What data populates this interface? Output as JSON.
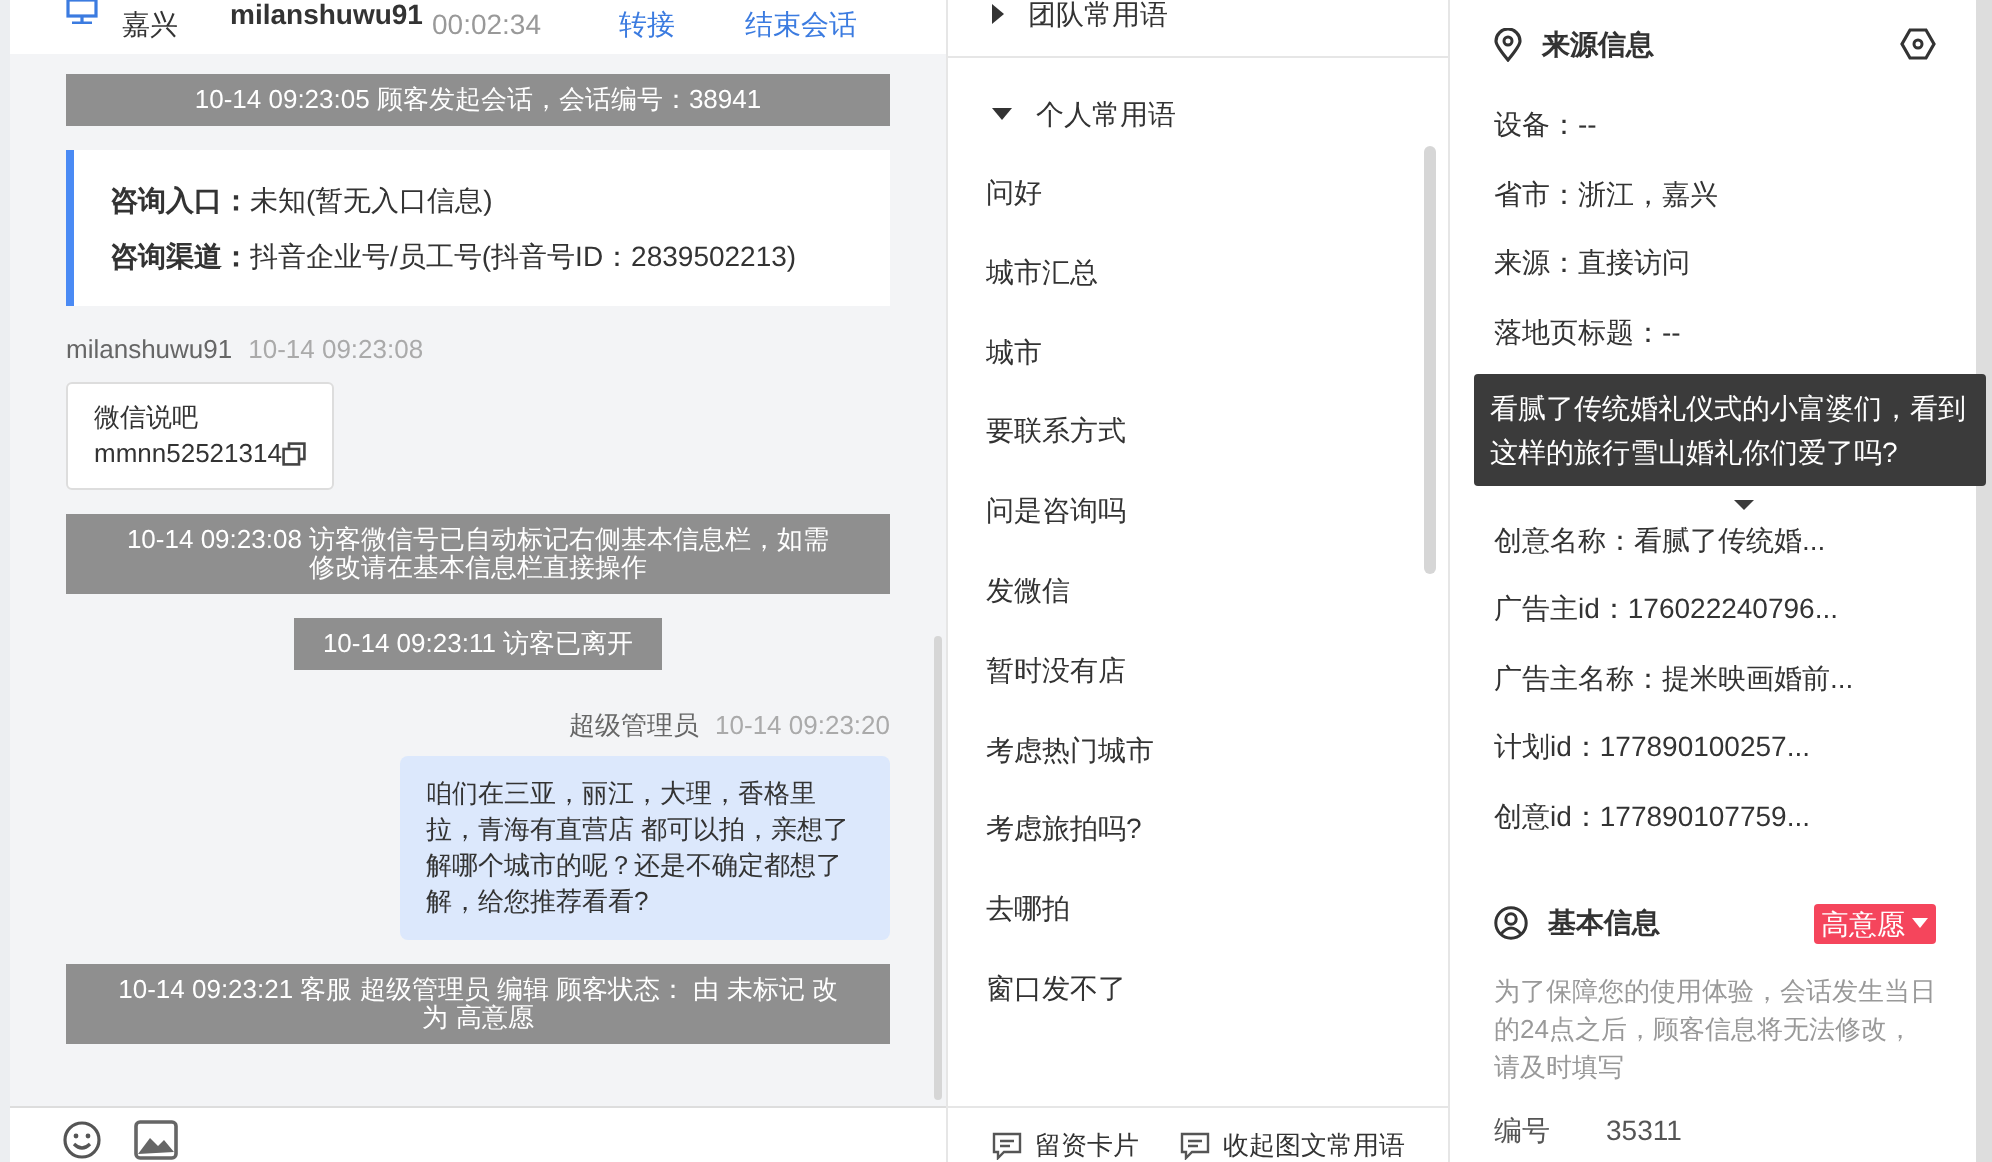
{
  "header": {
    "location": "嘉兴",
    "visitor_name": "milanshuwu91",
    "duration": "00:02:34",
    "actions": [
      "转接",
      "结束会话"
    ]
  },
  "chat": {
    "messages": [
      {
        "kind": "system",
        "text": "10-14 09:23:05 顾客发起会话，会话编号：38941"
      },
      {
        "kind": "entry_info",
        "rows": [
          {
            "label": "咨询入口：",
            "value": "未知(暂无入口信息)"
          },
          {
            "label": "咨询渠道：",
            "value": "抖音企业号/员工号(抖音号ID：2839502213)"
          }
        ]
      },
      {
        "kind": "visitor",
        "sender": "milanshuwu91",
        "time": "10-14 09:23:08",
        "lines": [
          "微信说吧",
          "mmnn52521314"
        ]
      },
      {
        "kind": "system",
        "text": "10-14 09:23:08 访客微信号已自动标记右侧基本信息栏，如需修改请在基本信息栏直接操作"
      },
      {
        "kind": "system",
        "text": "10-14 09:23:11 访客已离开"
      },
      {
        "kind": "agent",
        "sender": "超级管理员",
        "time": "10-14 09:23:20",
        "lines": [
          "咱们在三亚，丽江，大理，香格里拉，青海有直营店 都可以拍，亲想了解哪个城市的呢？还是不确定都想了解，给您推荐看看?"
        ]
      },
      {
        "kind": "system",
        "text": "10-14 09:23:21 客服 超级管理员 编辑 顾客状态： 由 未标记 改为 高意愿"
      }
    ]
  },
  "phrases": {
    "groups": [
      {
        "title": "团队常用语",
        "expanded": false
      },
      {
        "title": "个人常用语",
        "expanded": true,
        "items": [
          "问好",
          "城市汇总",
          "城市",
          "要联系方式",
          "问是咨询吗",
          "发微信",
          "暂时没有店",
          "考虑热门城市",
          "考虑旅拍吗?",
          "去哪拍",
          "窗口发不了"
        ]
      }
    ],
    "footer": [
      "留资卡片",
      "收起图文常用语"
    ]
  },
  "source_info": {
    "title": "来源信息",
    "fields": [
      {
        "text": "设备：--"
      },
      {
        "text": "省市：浙江，嘉兴"
      },
      {
        "text": "来源：直接访问"
      },
      {
        "text": "落地页标题：--"
      },
      {
        "kind": "tooltip",
        "text": "看腻了传统婚礼仪式的小富婆们，看到这样的旅行雪山婚礼你们爱了吗?"
      },
      {
        "text": "创意名称：看腻了传统婚..."
      },
      {
        "text": "广告主id：176022240796..."
      },
      {
        "text": "广告主名称：提米映画婚前..."
      },
      {
        "text": "计划id：177890100257..."
      },
      {
        "text": "创意id：177890107759..."
      }
    ]
  },
  "basic_info": {
    "title": "基本信息",
    "status_tag": "高意愿",
    "notice": "为了保障您的使用体验，会话发生当日的24点之后，顾客信息将无法修改，请及时填写",
    "fields": [
      {
        "label": "编号",
        "value": "35311"
      }
    ]
  }
}
